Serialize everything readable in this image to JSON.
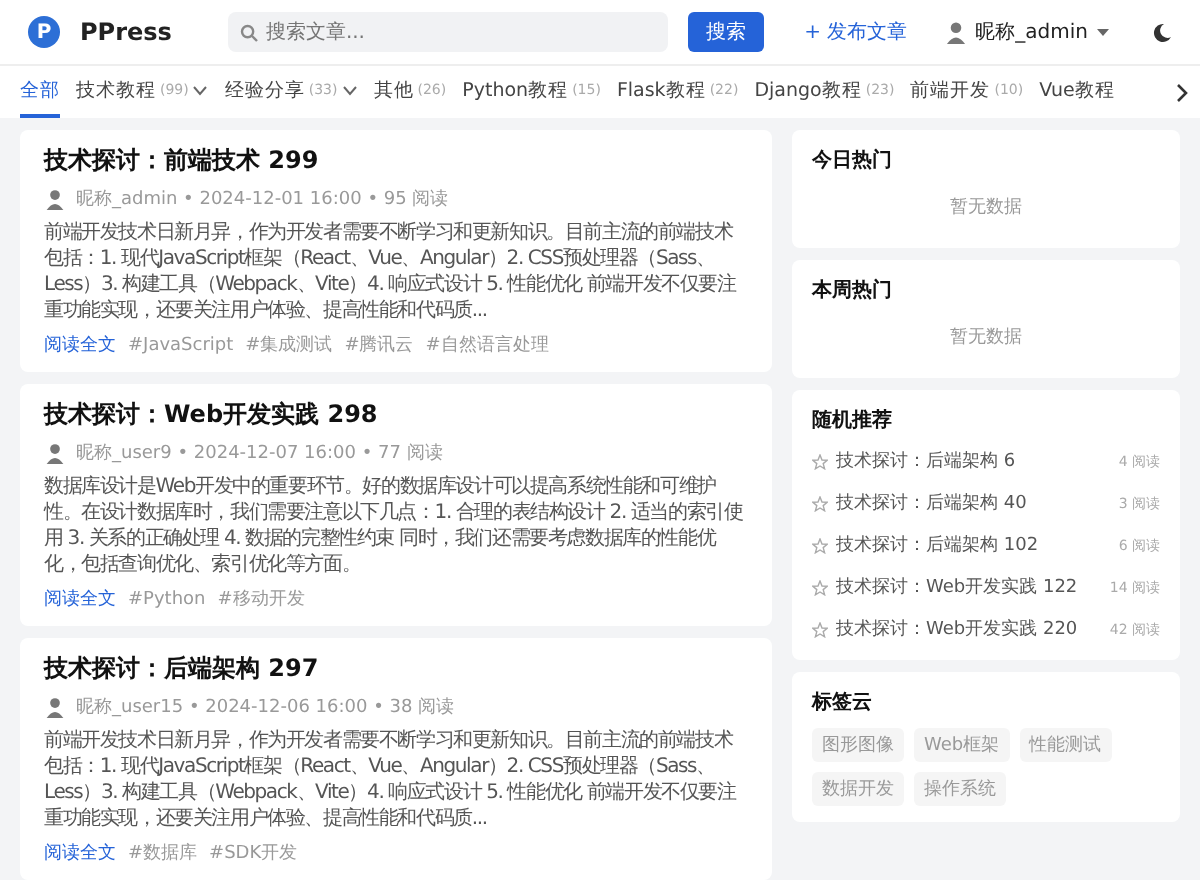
{
  "header": {
    "logo_letter": "P",
    "brand": "PPress",
    "search": {
      "placeholder": "搜索文章..."
    },
    "search_button": "搜索",
    "publish_link": "+ 发布文章",
    "user": "昵称_admin"
  },
  "nav": {
    "tabs": [
      {
        "label": "全部",
        "selected": true,
        "dropdown": false
      },
      {
        "label": "技术教程",
        "count": "(99)",
        "selected": false,
        "dropdown": true
      },
      {
        "label": "经验分享",
        "count": "(33)",
        "selected": false,
        "dropdown": true
      },
      {
        "label": "其他",
        "count": "(26)",
        "selected": false,
        "dropdown": false
      },
      {
        "label": "Python教程",
        "count": "(15)",
        "selected": false,
        "dropdown": false
      },
      {
        "label": "Flask教程",
        "count": "(22)",
        "selected": false,
        "dropdown": false
      },
      {
        "label": "Django教程",
        "count": "(23)",
        "selected": false,
        "dropdown": false
      },
      {
        "label": "前端开发",
        "count": "(10)",
        "selected": false,
        "dropdown": false
      },
      {
        "label": "Vue教程",
        "selected": false,
        "dropdown": false
      }
    ]
  },
  "posts": [
    {
      "title": "技术探讨：前端技术 299",
      "meta": "昵称_admin • 2024-12-01 16:00 • 95 阅读",
      "excerpt": "前端开发技术日新月异，作为开发者需要不断学习和更新知识。目前主流的前端技术包括：1. 现代JavaScript框架（React、Vue、Angular）2. CSS预处理器（Sass、Less）3. 构建工具（Webpack、Vite）4. 响应式设计 5. 性能优化 前端开发不仅要注重功能实现，还要关注用户体验、提高性能和代码质...",
      "read_more": "阅读全文",
      "tags": [
        "#JavaScript",
        "#集成测试",
        "#腾讯云",
        "#自然语言处理"
      ]
    },
    {
      "title": "技术探讨：Web开发实践 298",
      "meta": "昵称_user9 • 2024-12-07 16:00 • 77 阅读",
      "excerpt": "数据库设计是Web开发中的重要环节。好的数据库设计可以提高系统性能和可维护性。在设计数据库时，我们需要注意以下几点：1. 合理的表结构设计 2. 适当的索引使用 3. 关系的正确处理 4. 数据的完整性约束 同时，我们还需要考虑数据库的性能优化，包括查询优化、索引优化等方面。",
      "read_more": "阅读全文",
      "tags": [
        "#Python",
        "#移动开发"
      ]
    },
    {
      "title": "技术探讨：后端架构 297",
      "meta": "昵称_user15 • 2024-12-06 16:00 • 38 阅读",
      "excerpt": "前端开发技术日新月异，作为开发者需要不断学习和更新知识。目前主流的前端技术包括：1. 现代JavaScript框架（React、Vue、Angular）2. CSS预处理器（Sass、Less）3. 构建工具（Webpack、Vite）4. 响应式设计 5. 性能优化 前端开发不仅要注重功能实现，还要关注用户体验、提高性能和代码质...",
      "read_more": "阅读全文",
      "tags": [
        "#数据库",
        "#SDK开发"
      ]
    }
  ],
  "sidebar": [
    {
      "kind": "empty",
      "title": "今日热门",
      "message": "暂无数据"
    },
    {
      "kind": "empty",
      "title": "本周热门",
      "message": "暂无数据"
    },
    {
      "kind": "list",
      "title": "随机推荐",
      "items": [
        {
          "title": "技术探讨：后端架构 6",
          "views": "4 阅读"
        },
        {
          "title": "技术探讨：后端架构 40",
          "views": "3 阅读"
        },
        {
          "title": "技术探讨：后端架构 102",
          "views": "6 阅读"
        },
        {
          "title": "技术探讨：Web开发实践 122",
          "views": "14 阅读"
        },
        {
          "title": "技术探讨：Web开发实践 220",
          "views": "42 阅读"
        }
      ]
    },
    {
      "kind": "tags",
      "title": "标签云",
      "tags": [
        "图形图像",
        "Web框架",
        "性能测试",
        "数据开发",
        "操作系统"
      ]
    }
  ]
}
